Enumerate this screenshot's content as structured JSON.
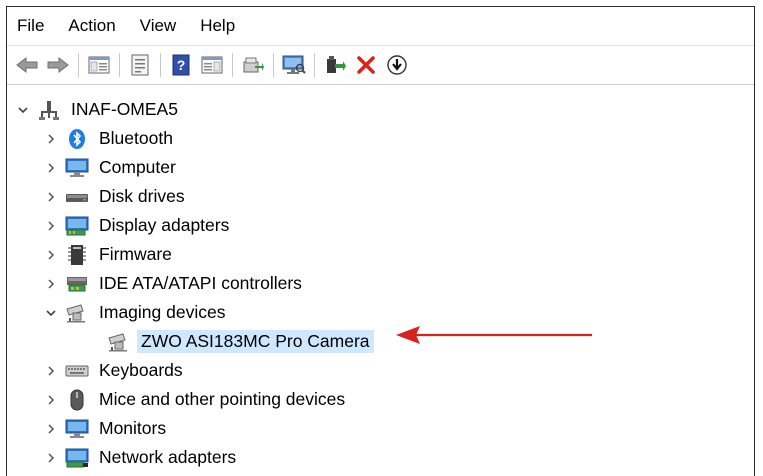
{
  "menu": [
    "File",
    "Action",
    "View",
    "Help"
  ],
  "toolbar": {
    "icons": [
      "back-arrow-icon",
      "forward-arrow-icon",
      "show-hide-tree-icon",
      "properties-icon",
      "help-icon",
      "action-pane-icon",
      "update-driver-icon",
      "monitor-scan-icon",
      "enable-device-icon",
      "uninstall-x-icon",
      "download-circle-icon"
    ],
    "accent_red": "#d9221c"
  },
  "tree": {
    "root": "INAF-OMEA5",
    "categories": [
      {
        "label": "Bluetooth",
        "expanded": false
      },
      {
        "label": "Computer",
        "expanded": false
      },
      {
        "label": "Disk drives",
        "expanded": false
      },
      {
        "label": "Display adapters",
        "expanded": false
      },
      {
        "label": "Firmware",
        "expanded": false
      },
      {
        "label": "IDE ATA/ATAPI controllers",
        "expanded": false
      },
      {
        "label": "Imaging devices",
        "expanded": true
      },
      {
        "label": "Keyboards",
        "expanded": false
      },
      {
        "label": "Mice and other pointing devices",
        "expanded": false
      },
      {
        "label": "Monitors",
        "expanded": false
      },
      {
        "label": "Network adapters",
        "expanded": false
      }
    ],
    "imaging_child": "ZWO ASI183MC Pro Camera"
  },
  "colors": {
    "selection": "#cde8ff",
    "annotation_arrow": "#d9221c"
  }
}
